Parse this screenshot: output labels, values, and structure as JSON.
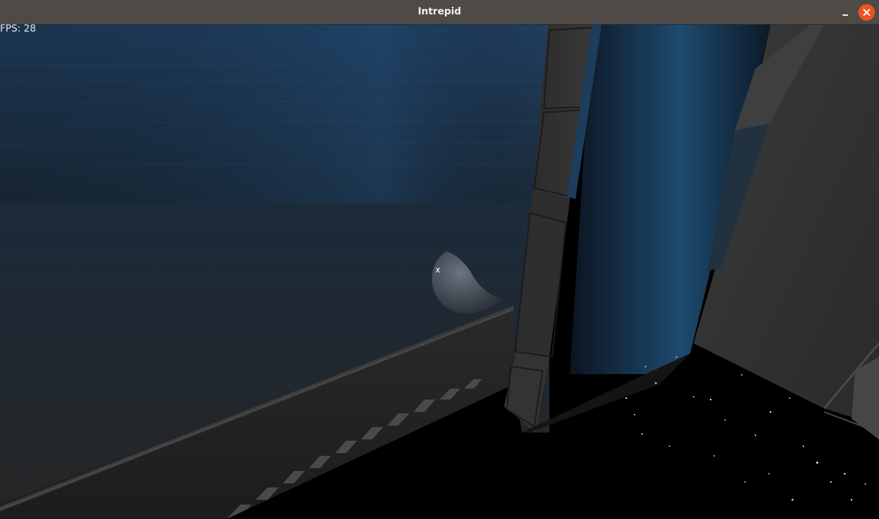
{
  "window": {
    "title": "Intrepid"
  },
  "hud": {
    "fps_text": "FPS: 28",
    "crosshair": "x"
  },
  "colors": {
    "titlebar": "#4f4a45",
    "close_button": "#e95420",
    "sky": "#1d3a5a"
  },
  "icons": {
    "minimize": "minimize-icon",
    "close": "close-icon"
  }
}
